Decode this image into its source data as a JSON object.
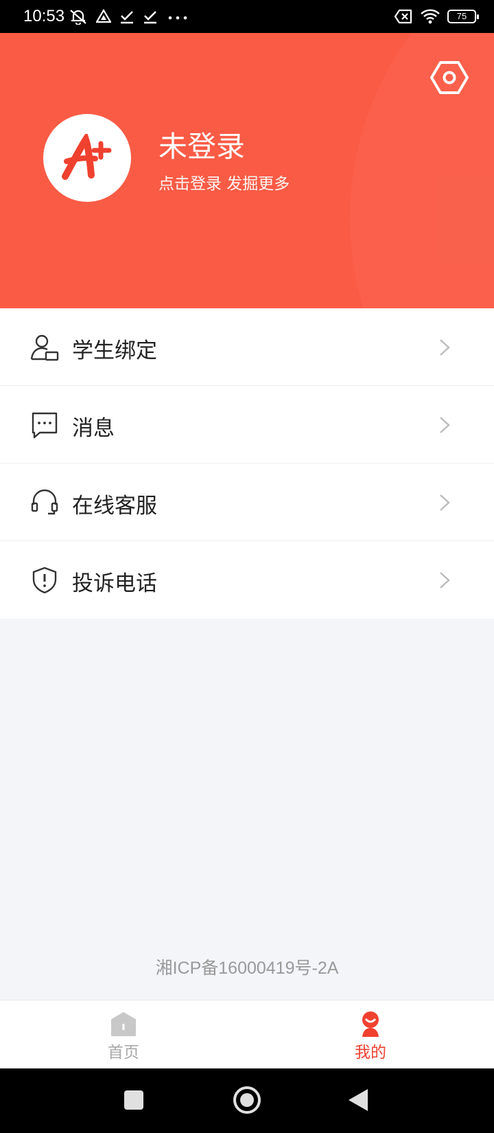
{
  "status_bar": {
    "time": "10:53",
    "battery": "75",
    "left_icons": [
      "mute-icon",
      "alert-triangle-icon",
      "download-check-icon",
      "download-check-icon",
      "more-dots-icon"
    ],
    "right_icons": [
      "sim-cross-icon",
      "wifi-icon",
      "battery-icon"
    ]
  },
  "header": {
    "background": "#fa5b45",
    "user_name": "未登录",
    "user_subtitle": "点击登录 发掘更多",
    "avatar_logo": "A+"
  },
  "menu": {
    "items": [
      {
        "label": "学生绑定",
        "icon": "student-bind-icon"
      },
      {
        "label": "消息",
        "icon": "message-icon"
      },
      {
        "label": "在线客服",
        "icon": "headset-icon"
      },
      {
        "label": "投诉电话",
        "icon": "shield-alert-icon"
      }
    ]
  },
  "footer": {
    "icp": "湘ICP备16000419号-2A"
  },
  "tabbar": {
    "home_label": "首页",
    "mine_label": "我的",
    "active_color": "#f0412f",
    "inactive_color": "#a8a8a8"
  }
}
